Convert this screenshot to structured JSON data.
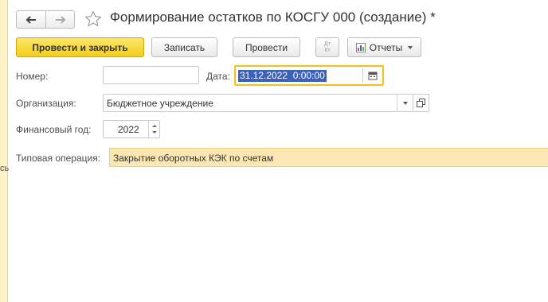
{
  "window": {
    "title": "Формирование остатков по КОСГУ 000 (создание) *",
    "left_clip_text": "сь"
  },
  "nav": {
    "back_icon": "arrow-left-icon",
    "forward_icon": "arrow-right-icon",
    "favorite_icon": "star-icon"
  },
  "toolbar": {
    "post_close_label": "Провести и закрыть",
    "save_label": "Записать",
    "post_label": "Провести",
    "dtkt_top": "Дт",
    "dtkt_bottom": "Кт",
    "reports_label": "Отчеты"
  },
  "form": {
    "number": {
      "label": "Номер:",
      "value": ""
    },
    "date": {
      "label": "Дата:",
      "value": "31.12.2022  0:00:00"
    },
    "organization": {
      "label": "Организация:",
      "value": "Бюджетное учреждение"
    },
    "fiscal_year": {
      "label": "Финансовый год:",
      "value": "2022"
    },
    "typical_operation": {
      "label": "Типовая операция:",
      "value": "Закрытие оборотных КЭК по счетам"
    }
  },
  "colors": {
    "primary_button": "#f3cf1b",
    "date_focus_border": "#f0c020",
    "selection": "#3b62b8",
    "operation_field_bg": "#fbe7b2",
    "left_strip": "#fbf3c6"
  }
}
